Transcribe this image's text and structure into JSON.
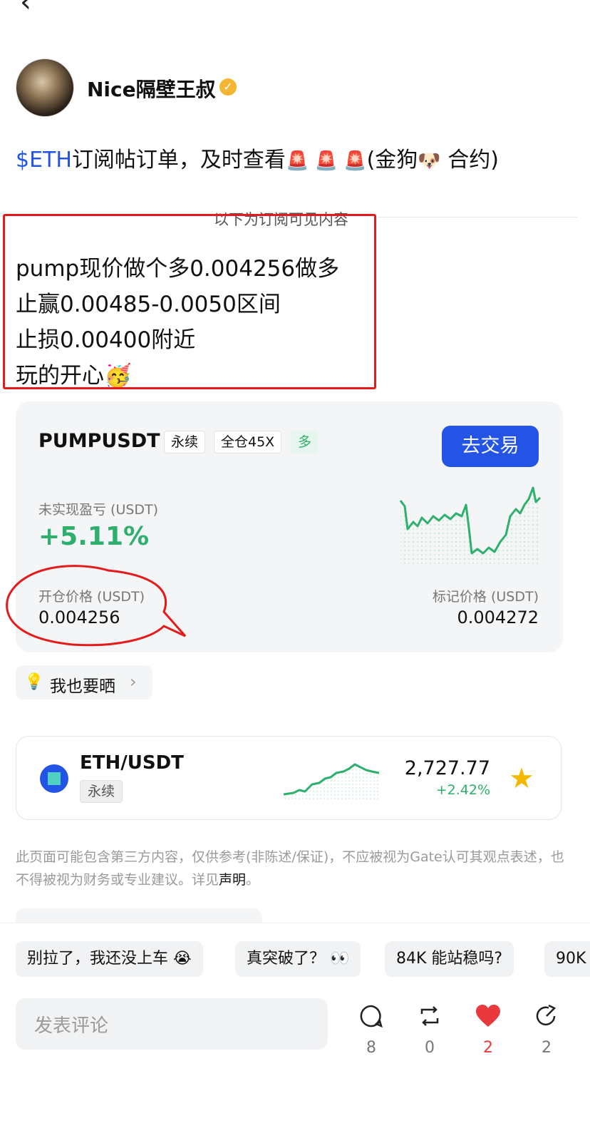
{
  "nav": {
    "back_glyph": "‹"
  },
  "post": {
    "author": "Nice隔壁王叔",
    "title_tag": "$ETH",
    "title_text": "订阅帖订单，及时查看",
    "title_emojis": "🚨 🚨 🚨",
    "title_suffix_1": "(金狗",
    "title_emoji_dog": "🐶",
    "title_suffix_2": " 合约)",
    "hidden_label": "以下为订阅可见内容",
    "lines": [
      "pump现价做个多0.004256做多",
      "止赢0.00485-0.0050区间",
      "止损0.00400附近",
      "玩的开心🥳"
    ]
  },
  "position": {
    "symbol": "PUMPUSDT",
    "tags": [
      "永续",
      "全仓45X",
      "多"
    ],
    "trade_button": "去交易",
    "pnl_label": "未实现盈亏 (USDT)",
    "pnl_value": "+5.11%",
    "open_label": "开仓价格 (USDT)",
    "open_value": "0.004256",
    "mark_label": "标记价格 (USDT)",
    "mark_value": "0.004272"
  },
  "share": {
    "label": "我也要晒"
  },
  "ticker": {
    "symbol": "ETH/USDT",
    "tag": "永续",
    "price": "2,727.77",
    "change": "+2.42%"
  },
  "disclaimer": {
    "text": "此页面可能包含第三方内容，仅供参考(非陈述/保证)，不应被视为Gate认可其观点表述，也不得被视为财务或专业建议。详见",
    "link": "声明",
    "end": "。"
  },
  "chips": [
    "别拉了，我还没上车 😭",
    "真突破了？ 👀",
    "84K 能站稳吗?",
    "90K"
  ],
  "comment": {
    "placeholder": "发表评论"
  },
  "actions": [
    {
      "icon": "comment-icon",
      "count": "8"
    },
    {
      "icon": "repost-icon",
      "count": "0"
    },
    {
      "icon": "heart-icon",
      "count": "2"
    },
    {
      "icon": "share-icon",
      "count": "2"
    }
  ],
  "colors": {
    "accent": "#2354e6",
    "up": "#2eaf6d",
    "like": "#e8393c",
    "annotation": "#e31b1b"
  }
}
